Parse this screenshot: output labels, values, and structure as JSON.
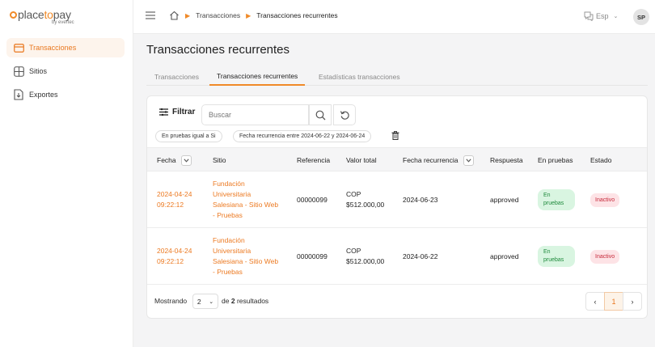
{
  "brand": {
    "name_left": "place",
    "name_mid": "to",
    "name_right": "pay",
    "sub": "by evertec"
  },
  "sidebar": {
    "items": [
      {
        "label": "Transacciones",
        "icon": "credit-card-icon",
        "active": true
      },
      {
        "label": "Sitios",
        "icon": "grid-icon",
        "active": false
      },
      {
        "label": "Exportes",
        "icon": "download-file-icon",
        "active": false
      }
    ]
  },
  "topbar": {
    "breadcrumb": [
      "Transacciones",
      "Transacciones recurrentes"
    ],
    "language": "Esp",
    "user_initials": "SP"
  },
  "page": {
    "title": "Transacciones recurrentes"
  },
  "tabs": [
    "Transacciones",
    "Transacciones recurrentes",
    "Estadísticas transacciones"
  ],
  "filters": {
    "filter_label": "Filtrar",
    "search_placeholder": "Buscar",
    "chips": [
      "En pruebas igual a Si",
      "Fecha recurrencia entre 2024-06-22 y 2024-06-24"
    ]
  },
  "table": {
    "columns": [
      "Fecha",
      "Sitio",
      "Referencia",
      "Valor total",
      "Fecha recurrencia",
      "Respuesta",
      "En pruebas",
      "Estado"
    ],
    "rows": [
      {
        "date": "2024-04-24",
        "time": "09:22:12",
        "site": [
          "Fundación",
          "Universitaria",
          "Salesiana - Sitio Web",
          "- Pruebas"
        ],
        "reference": "00000099",
        "currency": "COP",
        "amount": "$512.000,00",
        "recurrence": "2024-06-23",
        "response": "approved",
        "testing": [
          "En",
          "pruebas"
        ],
        "status": "Inactivo"
      },
      {
        "date": "2024-04-24",
        "time": "09:22:12",
        "site": [
          "Fundación",
          "Universitaria",
          "Salesiana - Sitio Web",
          "- Pruebas"
        ],
        "reference": "00000099",
        "currency": "COP",
        "amount": "$512.000,00",
        "recurrence": "2024-06-22",
        "response": "approved",
        "testing": [
          "En",
          "pruebas"
        ],
        "status": "Inactivo"
      }
    ]
  },
  "footer": {
    "showing": "Mostrando",
    "page_size": "2",
    "of": "de",
    "total": "2",
    "results": "resultados",
    "current_page": "1"
  },
  "colors": {
    "accent": "#f08a28",
    "link": "#ec7a22",
    "success_bg": "#d9f5e1",
    "danger_bg": "#fde3e6"
  }
}
